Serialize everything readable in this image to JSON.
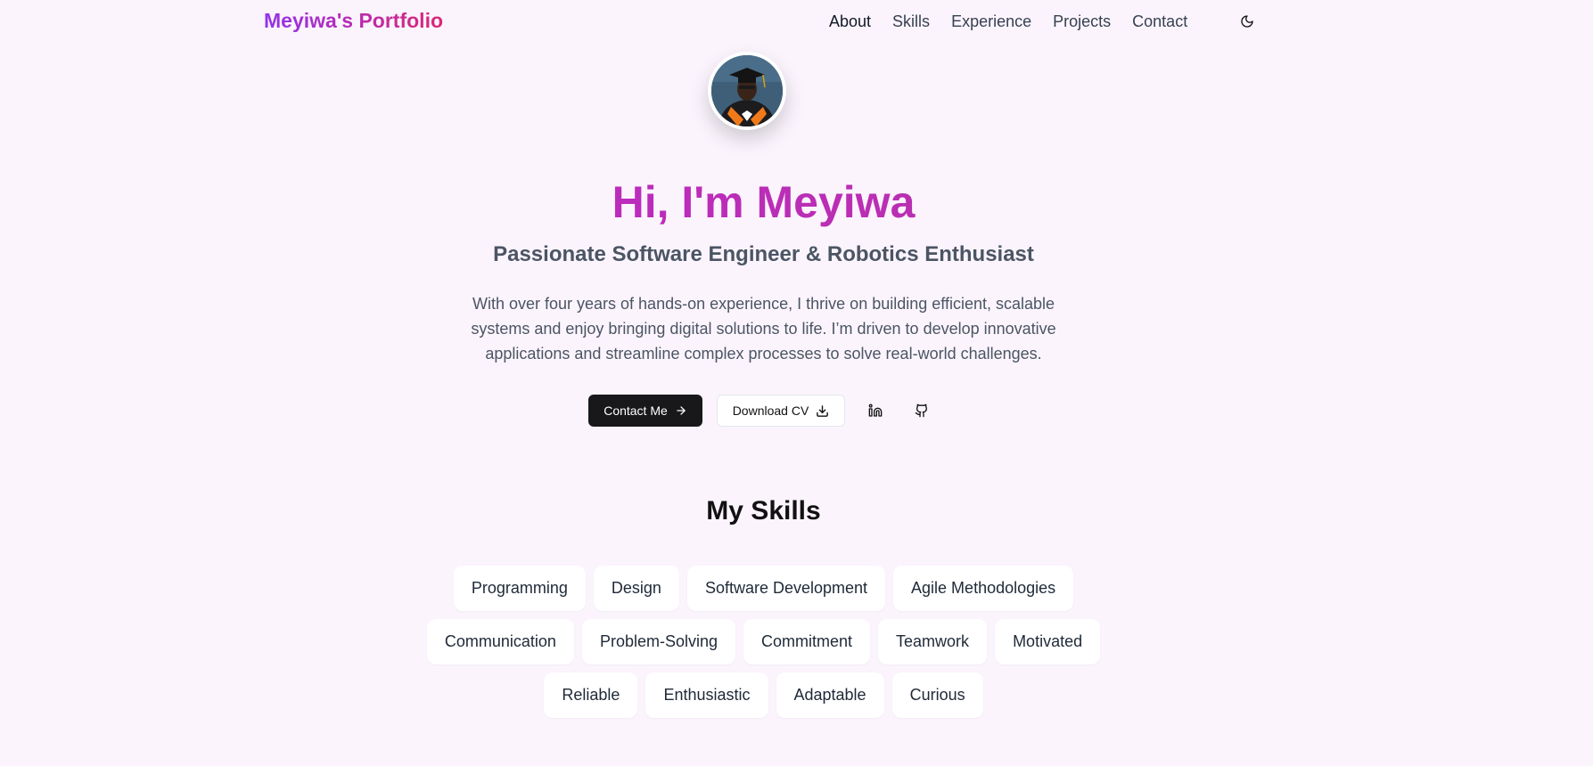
{
  "nav": {
    "brand": "Meyiwa's Portfolio",
    "links": [
      "About",
      "Skills",
      "Experience",
      "Projects",
      "Contact"
    ],
    "theme_toggle_icon": "moon-icon"
  },
  "hero": {
    "avatar_icon": "profile-photo",
    "title": "Hi, I'm Meyiwa",
    "subtitle": "Passionate Software Engineer & Robotics Enthusiast",
    "description": "With over four years of hands-on experience, I thrive on building efficient, scalable systems and enjoy bringing digital solutions to life. I’m driven to develop innovative applications and streamline complex processes to solve real-world challenges.",
    "contact_label": "Contact Me",
    "download_label": "Download CV",
    "linkedin_icon": "linkedin-icon",
    "github_icon": "github-icon"
  },
  "skills": {
    "title": "My Skills",
    "rows": [
      [
        "Programming",
        "Design",
        "Software Development",
        "Agile Methodologies"
      ],
      [
        "Communication",
        "Problem-Solving",
        "Commitment",
        "Teamwork",
        "Motivated"
      ],
      [
        "Reliable",
        "Enthusiastic",
        "Adaptable",
        "Curious"
      ]
    ]
  },
  "colors": {
    "background": "#fbf4fd",
    "accent": "#c026d3",
    "brand_start": "#9333ea",
    "brand_end": "#db2777",
    "primary_button": "#18181b"
  }
}
